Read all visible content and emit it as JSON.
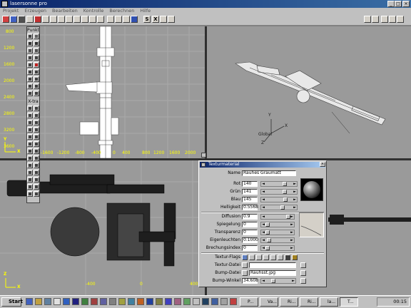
{
  "window": {
    "title": "lasersonne pro",
    "buttons": [
      "_",
      "□",
      "×"
    ]
  },
  "menu": [
    "Projekt",
    "Erzeugen",
    "Bearbeiten",
    "Kontrolle",
    "Berechnen",
    "Hilfe"
  ],
  "toolbar": {
    "left_icons": [
      "new",
      "open",
      "save",
      "undo",
      "redo",
      "select",
      "move",
      "rotate",
      "scale",
      "mirror",
      "copy",
      "cut",
      "paste",
      "delete",
      "link",
      "camera",
      "light",
      "render"
    ],
    "letter_s": "S",
    "letter_x": "X"
  },
  "viewport_front": {
    "y_ticks": [
      "800",
      "1200",
      "1600",
      "2000",
      "2400",
      "2800",
      "3200",
      "3600"
    ],
    "x_ticks": [
      "-1600",
      "-1200",
      "-800",
      "-400",
      "0",
      "400",
      "800",
      "1200",
      "1600",
      "2000"
    ],
    "axis_y": "Y",
    "axis_x": "X"
  },
  "viewport_perspective": {
    "global_label": "Global",
    "axis_x": "X",
    "axis_y": "Y",
    "axis_z": "Z"
  },
  "viewport_bottom": {
    "x_ticks": [
      "-400",
      "0",
      "400"
    ],
    "axis_y": "Z",
    "axis_x": "X"
  },
  "palette": {
    "title": "Punkt",
    "section2": "X-tra"
  },
  "dialog": {
    "title": "Texturmaterial",
    "name_label": "Name",
    "name_value": "Rauhes Graumatt",
    "rot_label": "Rot",
    "rot_value": "140",
    "gruen_label": "Grün",
    "gruen_value": "141",
    "blau_label": "Blau",
    "blau_value": "145",
    "hell_label": "Helligkeit",
    "hell_value": "0.5568",
    "diffusion_label": "Diffusion",
    "diffusion_value": "0.9",
    "spiegelung_label": "Spiegelung",
    "spiegelung_value": "0",
    "transparenz_label": "Transparenz",
    "transparenz_value": "0",
    "eigen_label": "Eigenleuchten",
    "eigen_value": "0.1000",
    "brechung_label": "Brechungsindex",
    "brechung_value": "0",
    "flags_label": "Textur-Flags",
    "tdatei_label": "Textur-Datei",
    "tdatei_value": "",
    "bdatei_label": "Bump-Datei",
    "bdatei_value": "Rauhsst.jpg",
    "bwinkel_label": "Bump-Winkel",
    "bwinkel_value": "34.608"
  },
  "taskbar": {
    "start_label": "Start",
    "tasks": [
      "P...",
      "Va...",
      "Ri...",
      "Ri...",
      "la...",
      "T..."
    ],
    "clock": "00:15"
  },
  "colors": {
    "viewport": "#9a9a9a",
    "grid": "#a4a4a4",
    "title_blue": "#0a246a",
    "axis_yellow": "#ffff00",
    "model_white": "#ffffff",
    "model_dark": "#1e1e1e"
  }
}
